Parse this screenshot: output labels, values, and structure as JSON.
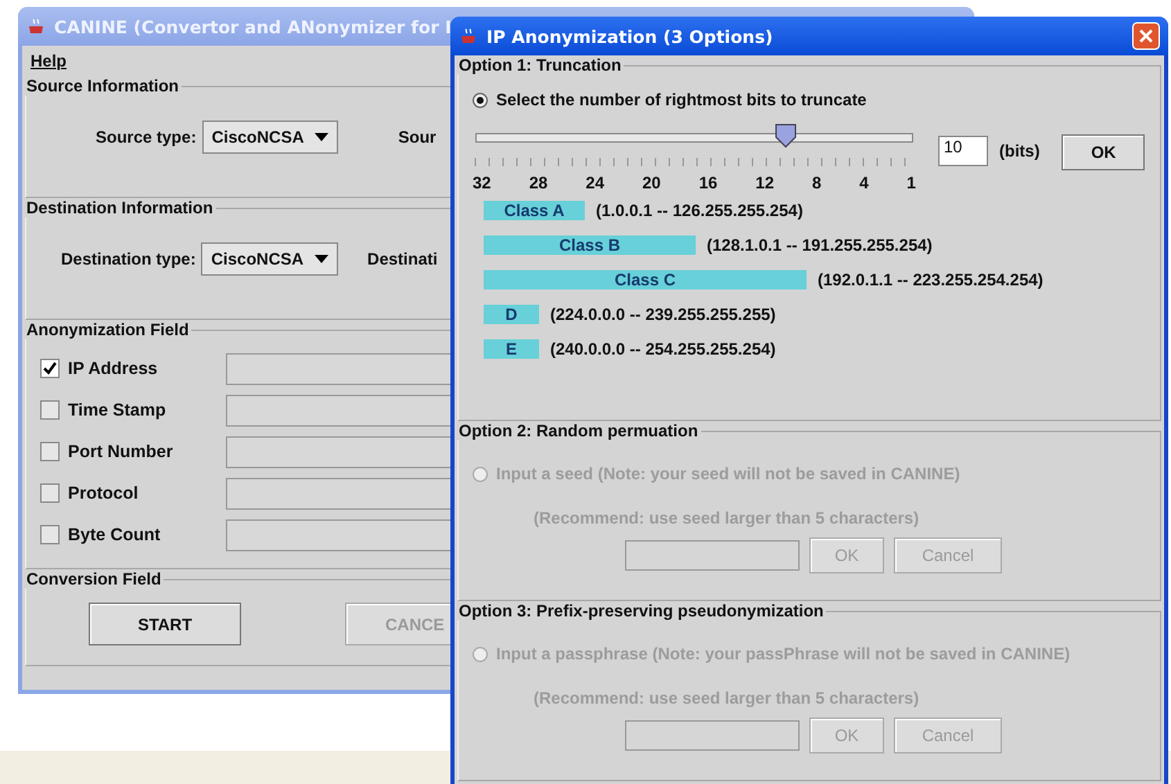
{
  "main_window": {
    "title": "CANINE (Convertor and ANonymizer for I",
    "menu": [
      "Help"
    ],
    "source": {
      "heading": "Source Information",
      "type_label": "Source type:",
      "type_value": "CiscoNCSA",
      "cut_label": "Sour"
    },
    "destination": {
      "heading": "Destination Information",
      "type_label": "Destination type:",
      "type_value": "CiscoNCSA",
      "cut_label": "Destinati"
    },
    "anonymization": {
      "heading": "Anonymization Field",
      "fields": [
        {
          "label": "IP Address",
          "checked": true
        },
        {
          "label": "Time Stamp",
          "checked": false
        },
        {
          "label": "Port Number",
          "checked": false
        },
        {
          "label": "Protocol",
          "checked": false
        },
        {
          "label": "Byte Count",
          "checked": false
        }
      ]
    },
    "conversion": {
      "heading": "Conversion Field",
      "buttons": [
        {
          "label": "START",
          "disabled": false
        },
        {
          "label": "CANCE",
          "disabled": true
        }
      ]
    }
  },
  "dialog": {
    "title": "IP Anonymization (3 Options)",
    "truncation": {
      "heading": "Option 1: Truncation",
      "radio": "Select the number of rightmost bits to truncate",
      "selected": true,
      "slider": {
        "level": 0.71
      },
      "ticks": [
        "32",
        "28",
        "24",
        "20",
        "16",
        "12",
        "8",
        "4",
        "1"
      ],
      "bits_value": "10",
      "unit": "(bits)",
      "ok": "OK",
      "classes": [
        {
          "label": "Class A",
          "range": "(1.0.0.1 -- 126.255.255.254)"
        },
        {
          "label": "Class B",
          "range": "(128.1.0.1 -- 191.255.255.254)"
        },
        {
          "label": "Class C",
          "range": "(192.0.1.1 -- 223.255.254.254)"
        },
        {
          "label": "D",
          "range": "(224.0.0.0 -- 239.255.255.255)"
        },
        {
          "label": "E",
          "range": "(240.0.0.0 -- 254.255.255.254)"
        }
      ]
    },
    "options": [
      {
        "heading": "Option 2: Random permuation",
        "radio": "Input a seed (Note: your seed will not be saved in CANINE)",
        "selected": false,
        "disabled": true,
        "note": "(Recommend: use seed larger than 5 characters)",
        "ok": "OK",
        "cancel": "Cancel"
      },
      {
        "heading": "Option 3: Prefix-preserving pseudonymization",
        "radio": "Input a passphrase (Note: your passPhrase will not be saved in CANINE)",
        "selected": false,
        "disabled": true,
        "note": "(Recommend: use seed larger than 5 characters)",
        "ok": "OK",
        "cancel": "Cancel"
      }
    ]
  }
}
